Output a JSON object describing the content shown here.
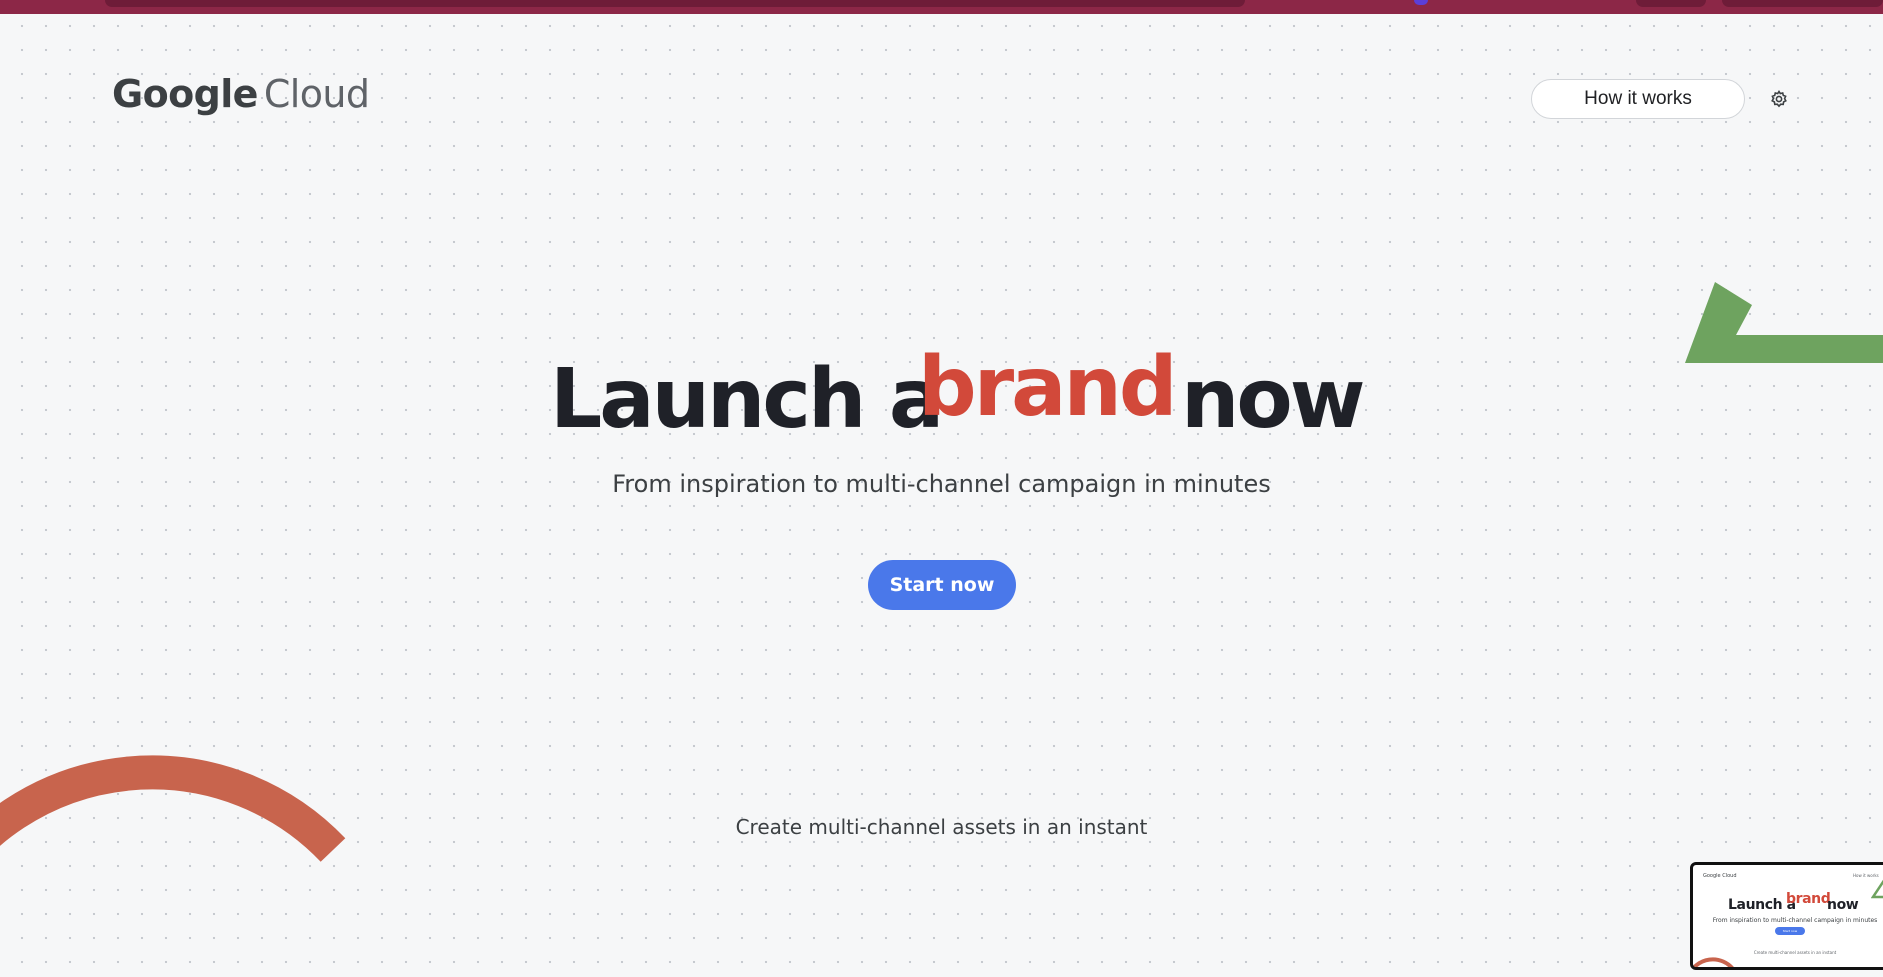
{
  "header": {
    "logo_google": "Google",
    "logo_cloud": "Cloud",
    "how_it_works_label": "How it works"
  },
  "hero": {
    "title_prefix": "Launch a",
    "title_highlight": "brand",
    "title_suffix": "now",
    "subtitle": "From inspiration to multi-channel campaign in minutes",
    "cta_label": "Start now"
  },
  "section": {
    "heading": "Create multi-channel assets in an instant"
  },
  "icons": {
    "settings": "gear-icon"
  },
  "colors": {
    "accent_blue": "#4a78ea",
    "brand_red": "#d2493a",
    "deco_orange": "#c8644d",
    "deco_green": "#6ea35f",
    "heading_dark": "#1f2128",
    "background": "#f6f7f8",
    "top_strip": "#8c2747"
  }
}
